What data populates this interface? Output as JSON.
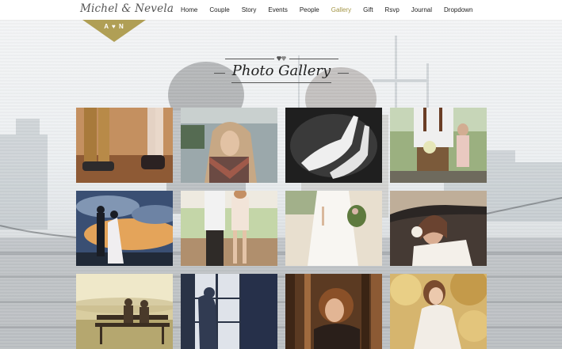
{
  "header": {
    "logo": "Michel & Nevela",
    "nav": [
      {
        "label": "Home"
      },
      {
        "label": "Couple"
      },
      {
        "label": "Story"
      },
      {
        "label": "Events"
      },
      {
        "label": "People"
      },
      {
        "label": "Gallery",
        "active": true
      },
      {
        "label": "Gift"
      },
      {
        "label": "Rsvp"
      },
      {
        "label": "Journal"
      },
      {
        "label": "Dropdown"
      }
    ],
    "accent_color": "#a39545"
  },
  "badge": {
    "monogram": "A ♥ N",
    "color": "#b09f55"
  },
  "section": {
    "title": "Photo Gallery"
  },
  "gallery": [
    {
      "name": "legs-shoes-photo"
    },
    {
      "name": "woman-scarf-photo"
    },
    {
      "name": "white-heels-photo"
    },
    {
      "name": "couple-bouquet-railway-photo"
    },
    {
      "name": "silhouette-couple-sky-photo"
    },
    {
      "name": "couple-walking-road-photo"
    },
    {
      "name": "bride-beach-photo"
    },
    {
      "name": "bride-in-car-photo"
    },
    {
      "name": "couple-bench-sunset-photo"
    },
    {
      "name": "couple-window-photo"
    },
    {
      "name": "woman-forest-photo"
    },
    {
      "name": "bride-autumn-photo"
    }
  ]
}
